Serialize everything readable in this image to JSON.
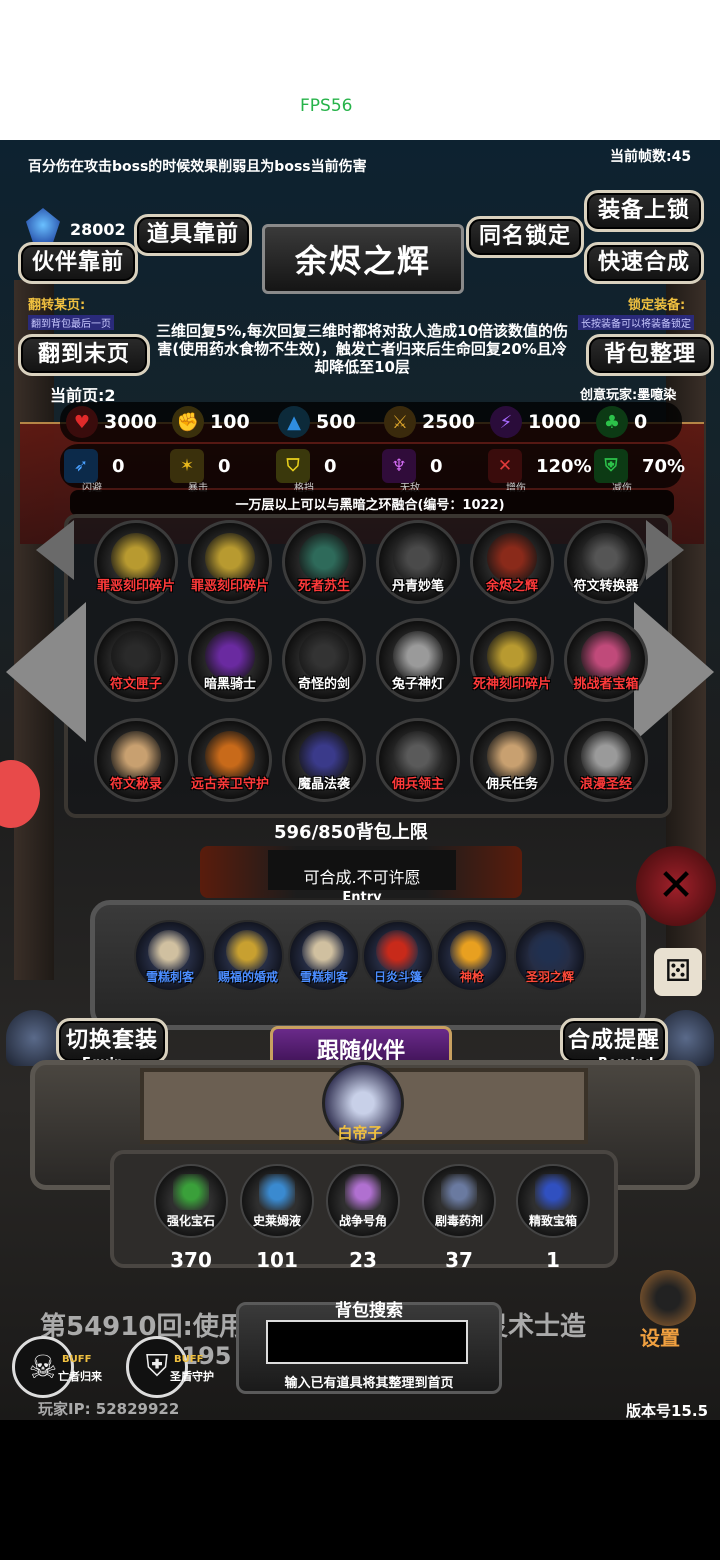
{
  "fps": "FPS56",
  "notice": "百分伤在攻击boss的时候效果削弱且为boss当前伤害",
  "frame_rate": "当前帧数:45",
  "currency": "28002",
  "buttons": {
    "partner_front": "伙伴靠前",
    "item_front": "道具靠前",
    "same_name_lock": "同名锁定",
    "equip_lock": "装备上锁",
    "quick_combine": "快速合成",
    "last_page": "翻到末页",
    "bag_sort": "背包整理",
    "switch_set": "切换套装",
    "switch_set_sub": "Equip",
    "combine_remind": "合成提醒",
    "combine_remind_sub": "Remind",
    "follow_partner": "跟随伙伴",
    "settings": "设置"
  },
  "item_title": "余烬之辉",
  "page_jump": {
    "label": "翻转某页:",
    "hint": "翻到背包最后一页"
  },
  "lock_equip": {
    "label": "锁定装备:",
    "hint": "长按装备可以将装备锁定"
  },
  "description": "三维回复5%,每次回复三维时都将对敌人造成10倍该数值的伤害(使用药水食物不生效)，触发亡者归来后生命回复20%且冷却降低至10层",
  "current_page": "当前页:2",
  "creator": "创意玩家:墨噫染",
  "stats_row1": [
    {
      "icon": "heart-icon",
      "value": "3000",
      "color": "#e02a2a"
    },
    {
      "icon": "strength-icon",
      "value": "100",
      "color": "#e8b81c"
    },
    {
      "icon": "armor-icon",
      "value": "500",
      "color": "#2f8de0"
    },
    {
      "icon": "sword-icon",
      "value": "2500",
      "color": "#d9a22a"
    },
    {
      "icon": "lightning-icon",
      "value": "1000",
      "color": "#8a3fe0"
    },
    {
      "icon": "clover-icon",
      "value": "0",
      "color": "#2cc24a"
    }
  ],
  "stats_row2": [
    {
      "icon": "dodge-icon",
      "value": "0",
      "label": "闪避",
      "color": "#2f8de0"
    },
    {
      "icon": "crit-icon",
      "value": "0",
      "label": "暴击",
      "color": "#e8b81c"
    },
    {
      "icon": "block-icon",
      "value": "0",
      "label": "格挡",
      "color": "#e8d01c"
    },
    {
      "icon": "invincible-icon",
      "value": "0",
      "label": "无敌",
      "color": "#c63fe0"
    },
    {
      "icon": "damage-up-icon",
      "value": "120%",
      "label": "增伤",
      "color": "#d02a2a"
    },
    {
      "icon": "damage-down-icon",
      "value": "70%",
      "label": "减伤",
      "color": "#2cc24a"
    }
  ],
  "fusion_note": "一万层以上可以与黑暗之环融合(编号：1022)",
  "bag_items": [
    {
      "name": "罪恶刻印碎片",
      "color": "red",
      "fill": "#b89a30"
    },
    {
      "name": "罪恶刻印碎片",
      "color": "red",
      "fill": "#b89a30"
    },
    {
      "name": "死者苏生",
      "color": "red",
      "fill": "#2e6a5a"
    },
    {
      "name": "丹青妙笔",
      "color": "white",
      "fill": "#4a4a4a"
    },
    {
      "name": "余烬之辉",
      "color": "red",
      "fill": "#8a2a1a"
    },
    {
      "name": "符文转换器",
      "color": "white",
      "fill": "#555555"
    },
    {
      "name": "符文匣子",
      "color": "red",
      "fill": "#2a2a2a"
    },
    {
      "name": "暗黑骑士",
      "color": "white",
      "fill": "#6a2aa0"
    },
    {
      "name": "奇怪的剑",
      "color": "white",
      "fill": "#333333"
    },
    {
      "name": "兔子神灯",
      "color": "white",
      "fill": "#9a9a9a"
    },
    {
      "name": "死神刻印碎片",
      "color": "red",
      "fill": "#b89a30"
    },
    {
      "name": "挑战者宝箱",
      "color": "red",
      "fill": "#c04a7a"
    },
    {
      "name": "符文秘录",
      "color": "red",
      "fill": "#c8a070"
    },
    {
      "name": "远古亲卫守护",
      "color": "red",
      "fill": "#c86a1a"
    },
    {
      "name": "魔晶法袭",
      "color": "white",
      "fill": "#3a3a8a"
    },
    {
      "name": "佣兵领主",
      "color": "red",
      "fill": "#5a5a5a"
    },
    {
      "name": "佣兵任务",
      "color": "white",
      "fill": "#c8a070"
    },
    {
      "name": "浪漫圣经",
      "color": "red",
      "fill": "#9a9a9a"
    }
  ],
  "bag_limit": "596/850背包上限",
  "combine_status": "可合成.不可许愿",
  "entry_label": "Entry",
  "equipped": [
    {
      "name": "雪糕刺客",
      "color": "blue",
      "fill": "#d0c0a0"
    },
    {
      "name": "赐福的婚戒",
      "color": "blue",
      "fill": "#c8a030"
    },
    {
      "name": "雪糕刺客",
      "color": "blue",
      "fill": "#d0c0a0"
    },
    {
      "name": "日炎斗篷",
      "color": "blue",
      "fill": "#c82a1a"
    },
    {
      "name": "神枪",
      "color": "redn",
      "fill": "#e8a020"
    },
    {
      "name": "圣羽之辉",
      "color": "redn",
      "fill": "#203050"
    }
  ],
  "partner_name": "白帝子",
  "consumables": [
    {
      "name": "强化宝石",
      "count": "370",
      "fill": "#3aa03a"
    },
    {
      "name": "史莱姆液",
      "count": "101",
      "fill": "#3a8ad0"
    },
    {
      "name": "战争号角",
      "count": "23",
      "fill": "#b070d0"
    },
    {
      "name": "剧毒药剂",
      "count": "37",
      "fill": "#6a7aa0"
    },
    {
      "name": "精致宝箱",
      "count": "1",
      "fill": "#3050c0"
    }
  ],
  "round_text": "第54910回:使用普",
  "round_text_right": "灵术士造",
  "round_number": "73195 5948",
  "bag_search": {
    "label": "背包搜索",
    "hint": "输入已有道具将其整理到首页",
    "value": ""
  },
  "buffs": [
    {
      "name": "亡者归来",
      "tag": "BUFF"
    },
    {
      "name": "圣盾守护",
      "tag": "BUFF"
    }
  ],
  "player_ip": "玩家IP:  52829922",
  "version": "版本号15.5"
}
